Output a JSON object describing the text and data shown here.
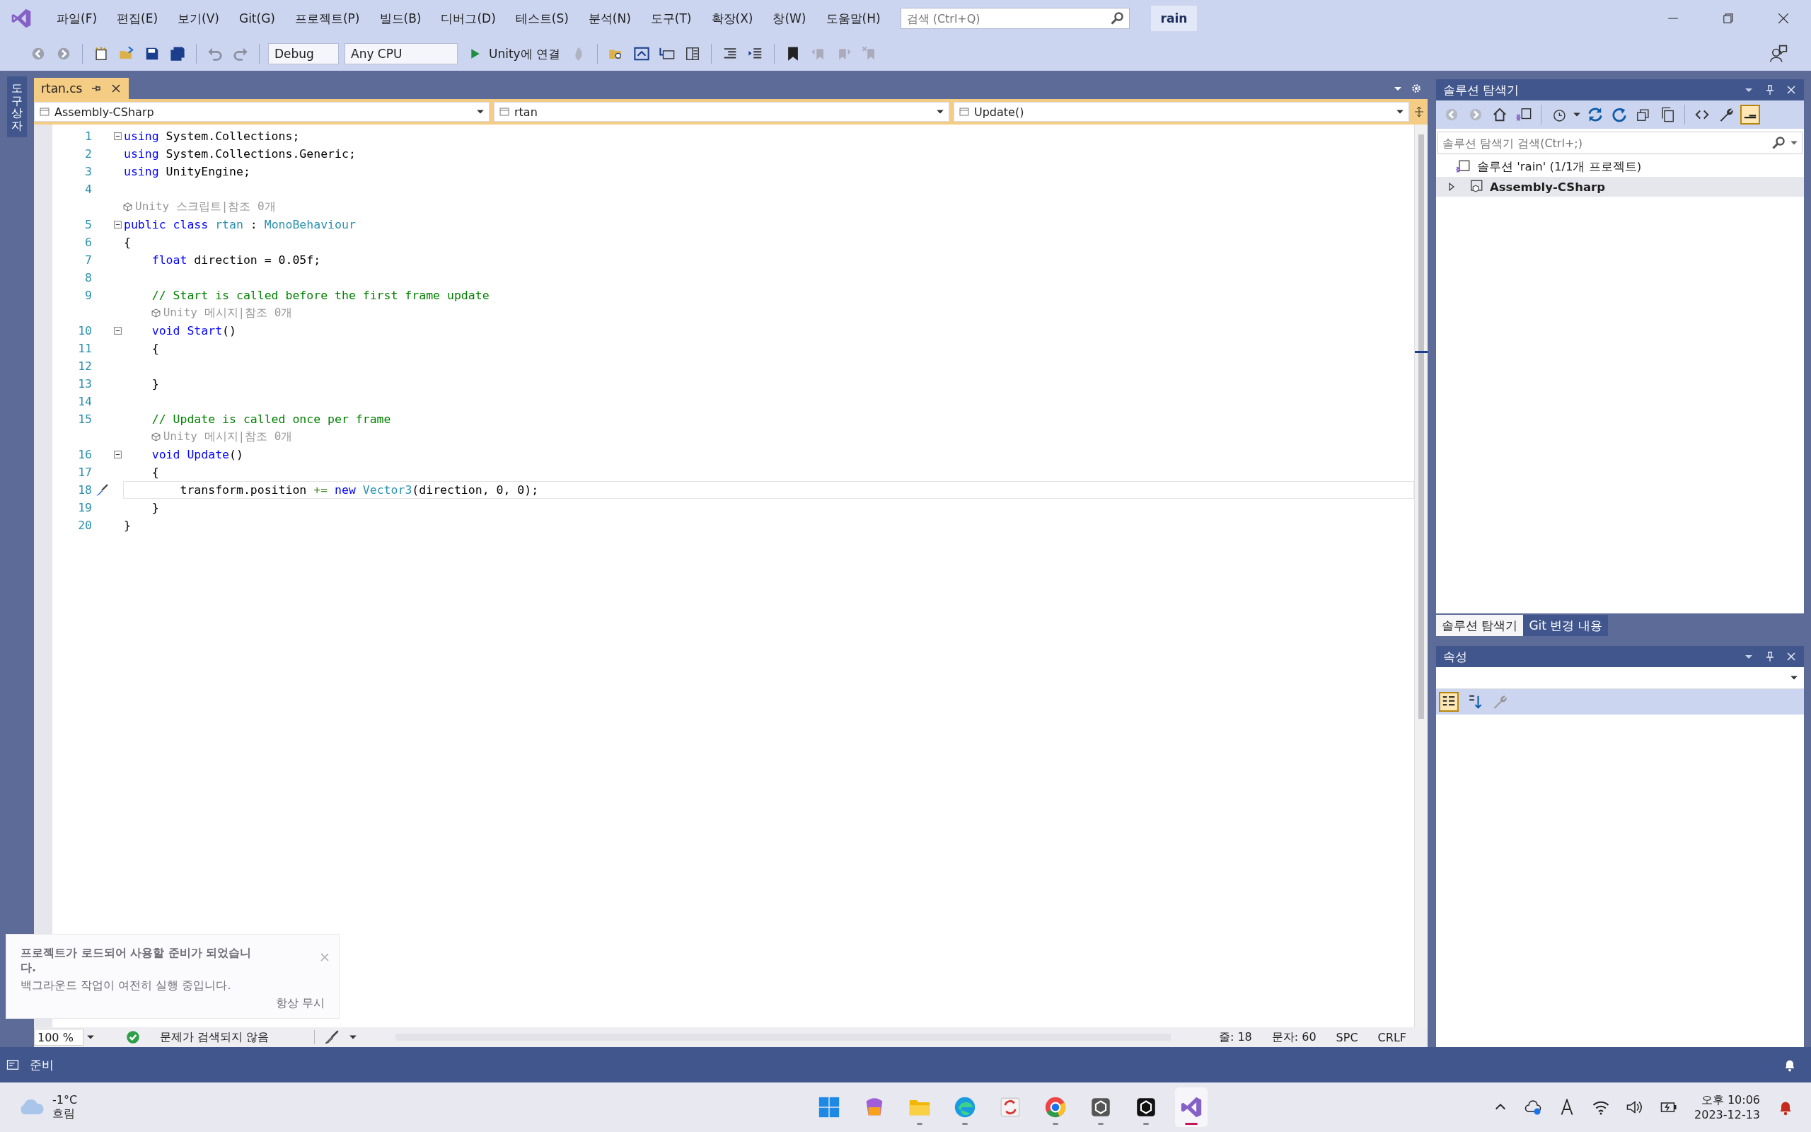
{
  "menu": [
    "파일(F)",
    "편집(E)",
    "보기(V)",
    "Git(G)",
    "프로젝트(P)",
    "빌드(B)",
    "디버그(D)",
    "테스트(S)",
    "분석(N)",
    "도구(T)",
    "확장(X)",
    "창(W)",
    "도움말(H)"
  ],
  "search": {
    "placeholder": "검색 (Ctrl+Q)"
  },
  "solution_badge": "rain",
  "toolbar": {
    "configuration": "Debug",
    "platform": "Any CPU",
    "run_label": "Unity에 연결"
  },
  "side_tab": "도구 상자",
  "editor": {
    "tabs": [
      {
        "label": "rtan.cs",
        "selected": true
      }
    ],
    "nav": [
      "Assembly-CSharp",
      "rtan",
      "Update()"
    ],
    "lines": [
      {
        "n": "1",
        "fold": true,
        "current": false,
        "tokens": [
          {
            "t": "using",
            "kind": "keyword"
          },
          {
            "t": " System.Collections;",
            "kind": "plain"
          }
        ]
      },
      {
        "n": "2",
        "fold": false,
        "current": false,
        "tokens": [
          {
            "t": "using",
            "kind": "keyword"
          },
          {
            "t": " System.Collections.Generic;",
            "kind": "plain"
          }
        ]
      },
      {
        "n": "3",
        "fold": false,
        "current": false,
        "tokens": [
          {
            "t": "using",
            "kind": "keyword"
          },
          {
            "t": " UnityEngine;",
            "kind": "plain"
          }
        ]
      },
      {
        "n": "4",
        "fold": false,
        "current": false
      },
      {
        "n": "5",
        "fold": true,
        "current": false,
        "lens": "Unity 스크립트|참조 0개",
        "tokens": [
          {
            "t": "public class",
            "kind": "keyword"
          },
          {
            "t": " rtan",
            "kind": "type"
          },
          {
            "t": " : ",
            "kind": "plain"
          },
          {
            "t": "MonoBehaviour",
            "kind": "type"
          }
        ]
      },
      {
        "n": "6",
        "fold": false,
        "current": false,
        "tokens": [
          {
            "t": "{",
            "kind": "plain"
          }
        ]
      },
      {
        "n": "7",
        "fold": false,
        "current": false,
        "tokens": [
          {
            "t": "    float",
            "kind": "keyword"
          },
          {
            "t": " direction = 0.05f;",
            "kind": "plain"
          }
        ]
      },
      {
        "n": "8",
        "fold": false,
        "current": false
      },
      {
        "n": "9",
        "fold": false,
        "current": false,
        "tokens": [
          {
            "t": "    // Start is called before the first frame update",
            "kind": "comment"
          }
        ]
      },
      {
        "n": "10",
        "fold": true,
        "current": false,
        "lens": "Unity 메시지|참조 0개",
        "tokens": [
          {
            "t": "    void Start",
            "kind": "keyword"
          },
          {
            "t": "()",
            "kind": "plain"
          }
        ]
      },
      {
        "n": "11",
        "fold": false,
        "current": false,
        "tokens": [
          {
            "t": "    {",
            "kind": "plain"
          }
        ]
      },
      {
        "n": "12",
        "fold": false,
        "current": false
      },
      {
        "n": "13",
        "fold": false,
        "current": false,
        "tokens": [
          {
            "t": "    }",
            "kind": "plain"
          }
        ]
      },
      {
        "n": "14",
        "fold": false,
        "current": false
      },
      {
        "n": "15",
        "fold": false,
        "current": false,
        "tokens": [
          {
            "t": "    // Update is called once per frame",
            "kind": "comment"
          }
        ]
      },
      {
        "n": "16",
        "fold": true,
        "current": false,
        "lens": "Unity 메시지|참조 0개",
        "tokens": [
          {
            "t": "    void Update",
            "kind": "keyword"
          },
          {
            "t": "()",
            "kind": "plain"
          }
        ]
      },
      {
        "n": "17",
        "fold": false,
        "current": false,
        "tokens": [
          {
            "t": "    {",
            "kind": "plain"
          }
        ]
      },
      {
        "n": "18",
        "fold": false,
        "current": true,
        "tokens": [
          {
            "t": "        transform.position ",
            "kind": "plain"
          },
          {
            "t": "+=",
            "kind": "operator"
          },
          {
            "t": " new",
            "kind": "keyword"
          },
          {
            "t": " Vector3",
            "kind": "type"
          },
          {
            "t": "(direction, 0, 0);",
            "kind": "plain"
          }
        ]
      },
      {
        "n": "19",
        "fold": false,
        "current": false,
        "tokens": [
          {
            "t": "    }",
            "kind": "plain"
          }
        ]
      },
      {
        "n": "20",
        "fold": false,
        "current": false,
        "tokens": [
          {
            "t": "}",
            "kind": "plain"
          }
        ]
      }
    ],
    "status": {
      "zoom": "100 %",
      "issues": "문제가 검색되지 않음",
      "line": "줄: 18",
      "col": "문자: 60",
      "spacing": "SPC",
      "eol": "CRLF"
    }
  },
  "toast": {
    "title": "프로젝트가 로드되어 사용할 준비가 되었습니다.",
    "body": "백그라운드 작업이 여전히 실행 중입니다.",
    "link": "항상 무시"
  },
  "solution_explorer": {
    "title": "솔루션 탐색기",
    "search": {
      "placeholder": "솔루션 탐색기 검색(Ctrl+;)"
    },
    "solution": "솔루션 'rain' (1/1개 프로젝트)",
    "projects": [
      {
        "label": "Assembly-CSharp",
        "expanded": false,
        "selected": true
      }
    ]
  },
  "panel_tabs": [
    {
      "label": "솔루션 탐색기",
      "selected": true
    },
    {
      "label": "Git 변경 내용",
      "selected": false
    }
  ],
  "properties": {
    "title": "속성"
  },
  "status_bar": "준비",
  "taskbar": {
    "weather": {
      "temp": "-1°C",
      "condition": "흐림"
    },
    "apps": [
      {
        "kind": "start",
        "running": false,
        "active": false
      },
      {
        "kind": "copilot",
        "running": false,
        "active": false
      },
      {
        "kind": "files",
        "running": true,
        "active": false
      },
      {
        "kind": "edge",
        "running": true,
        "active": false
      },
      {
        "kind": "sync",
        "running": false,
        "active": false
      },
      {
        "kind": "chrome",
        "running": true,
        "active": false
      },
      {
        "kind": "unityhub",
        "running": true,
        "active": false
      },
      {
        "kind": "unity",
        "running": true,
        "active": false
      },
      {
        "kind": "vs",
        "running": true,
        "active": true
      }
    ],
    "time": "오후 10:06",
    "date": "2023-12-13"
  }
}
